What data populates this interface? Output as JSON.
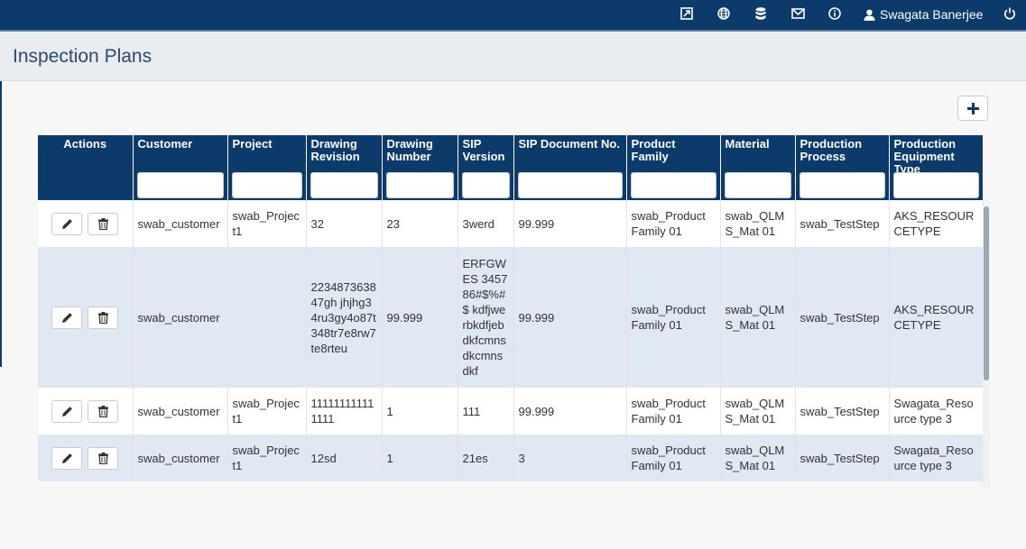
{
  "header": {
    "user_name": "Swagata Banerjee",
    "icons": [
      "export-icon",
      "globe-icon",
      "database-icon",
      "mail-icon",
      "info-icon",
      "user-icon",
      "power-icon"
    ]
  },
  "page": {
    "title": "Inspection Plans",
    "add_label": "+"
  },
  "colors": {
    "header_bg": "#0b3a6b",
    "row_alt_bg": "#dfe8f3",
    "title_color": "#2c4a6e"
  },
  "table": {
    "columns": [
      "Actions",
      "Customer",
      "Project",
      "Drawing Revision",
      "Drawing Number",
      "SIP Version",
      "SIP Document No.",
      "Product Family",
      "Material",
      "Production Process",
      "Production Equipment Type"
    ],
    "rows": [
      [
        "swab_customer",
        "swab_Project1",
        "32",
        "23",
        "3werd",
        "99.999",
        "swab_Product Family 01",
        "swab_QLMS_Mat 01",
        "swab_TestStep",
        "AKS_RESOURCETYPE"
      ],
      [
        "swab_customer",
        "",
        "223487363847gh jhjhg34ru3gy4o87t348tr7e8rw7te8rteu",
        "99.999",
        "ERFGWES 345786#$%#$ kdfjwerbkdfjebdkfcmnsdkcmnsdkf",
        "99.999",
        "swab_Product Family 01",
        "swab_QLMS_Mat 01",
        "swab_TestStep",
        "AKS_RESOURCETYPE"
      ],
      [
        "swab_customer",
        "swab_Project1",
        "111111111111111",
        "1",
        "111",
        "99.999",
        "swab_Product Family 01",
        "swab_QLMS_Mat 01",
        "swab_TestStep",
        "Swagata_Resource type 3"
      ],
      [
        "swab_customer",
        "swab_Project1",
        "12sd",
        "1",
        "21es",
        "3",
        "swab_Product Family 01",
        "swab_QLMS_Mat 01",
        "swab_TestStep",
        "Swagata_Resource type 3"
      ]
    ]
  }
}
